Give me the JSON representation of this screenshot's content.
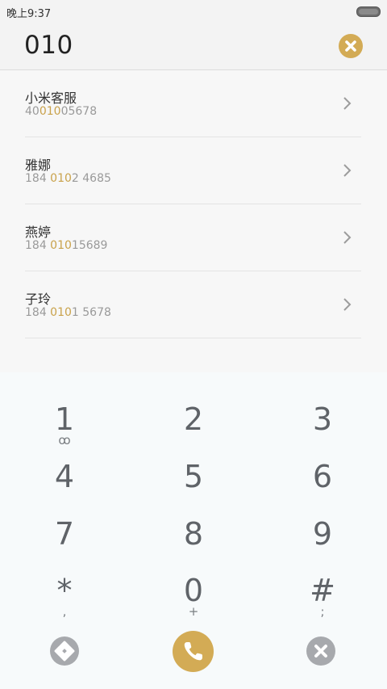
{
  "status_bar": {
    "time": "晚上9:37"
  },
  "header": {
    "typed_number": "010",
    "clear_icon": "clear-x-icon"
  },
  "results": [
    {
      "name": "小米客服",
      "number_pre": "40",
      "number_match": "010",
      "number_post": "05678"
    },
    {
      "name": "雅娜",
      "number_pre": "184 ",
      "number_match": "010",
      "number_post": "2 4685"
    },
    {
      "name": "燕婷",
      "number_pre": "184 ",
      "number_match": "010",
      "number_post": "15689"
    },
    {
      "name": "子玲",
      "number_pre": "184 ",
      "number_match": "010",
      "number_post": "1 5678"
    }
  ],
  "dialpad": {
    "keys": [
      {
        "digit": "1",
        "sub": "ꝏ"
      },
      {
        "digit": "2",
        "sub": ""
      },
      {
        "digit": "3",
        "sub": ""
      },
      {
        "digit": "4",
        "sub": ""
      },
      {
        "digit": "5",
        "sub": ""
      },
      {
        "digit": "6",
        "sub": ""
      },
      {
        "digit": "7",
        "sub": ""
      },
      {
        "digit": "8",
        "sub": ""
      },
      {
        "digit": "9",
        "sub": ""
      },
      {
        "digit": "*",
        "sub": ","
      },
      {
        "digit": "0",
        "sub": "+"
      },
      {
        "digit": "#",
        "sub": ";"
      }
    ]
  },
  "actions": {
    "collapse_icon": "dialpad-collapse-icon",
    "call_icon": "phone-icon",
    "delete_icon": "backspace-x-icon"
  },
  "colors": {
    "accent": "#d3ab55",
    "highlight": "#c9a24b",
    "secondary_button": "#a7a9ad"
  }
}
